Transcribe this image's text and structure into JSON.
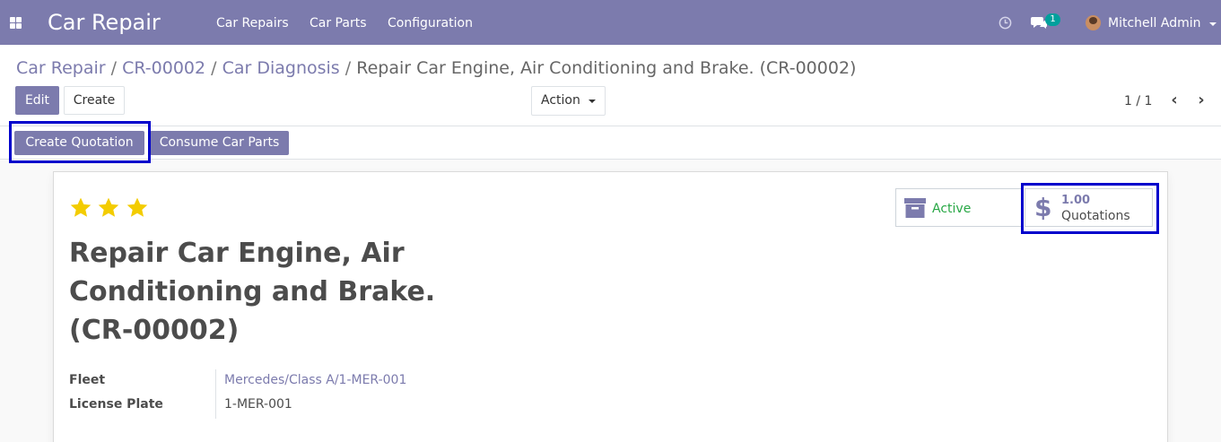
{
  "navbar": {
    "app_title": "Car Repair",
    "menu": [
      "Car Repairs",
      "Car Parts",
      "Configuration"
    ],
    "chat_count": "1",
    "user_name": "Mitchell Admin",
    "bg_color": "#7c7bad"
  },
  "breadcrumb": {
    "items": [
      "Car Repair",
      "CR-00002",
      "Car Diagnosis"
    ],
    "current": "Repair Car Engine, Air Conditioning and Brake. (CR-00002)",
    "separator": "/"
  },
  "toolbar": {
    "edit_label": "Edit",
    "create_label": "Create",
    "action_label": "Action",
    "pager": "1 / 1"
  },
  "statusbar": {
    "create_quotation_label": "Create Quotation",
    "consume_parts_label": "Consume Car Parts"
  },
  "record": {
    "priority_stars": 3,
    "title": "Repair Car Engine, Air Conditioning and Brake. (CR-00002)",
    "smart_buttons": {
      "active_label": "Active",
      "quotation_value": "1.00",
      "quotation_label": "Quotations"
    },
    "fields": [
      {
        "label": "Fleet",
        "value": "Mercedes/Class A/1-MER-001"
      },
      {
        "label": "License Plate",
        "value": "1-MER-001"
      }
    ]
  },
  "colors": {
    "primary": "#7c7bad",
    "highlight": "#0000cc",
    "star": "#f3cc00",
    "active_green": "#28a745",
    "badge": "#00a09d"
  },
  "icons": [
    "apps-grid-icon",
    "clock-icon",
    "chat-icon",
    "user-avatar",
    "archive-icon",
    "dollar-icon",
    "star-icon",
    "chevron-left-icon",
    "chevron-right-icon"
  ]
}
